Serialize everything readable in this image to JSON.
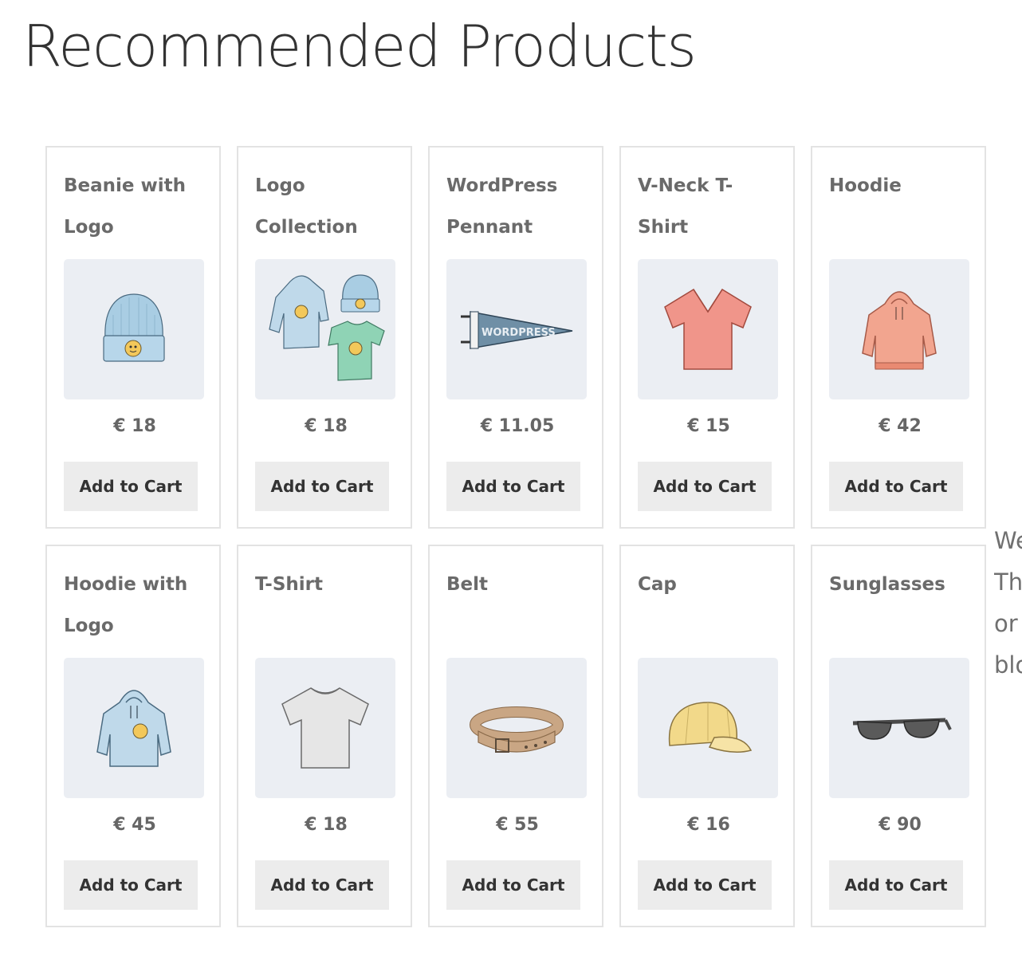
{
  "page": {
    "title": "Recommended Products"
  },
  "side_text": [
    "We",
    "Th",
    "or",
    "blo"
  ],
  "products": [
    {
      "name": "Beanie with Logo",
      "price": "€ 18",
      "cta": "Add to Cart",
      "icon": "beanie-icon"
    },
    {
      "name": "Logo Collection",
      "price": "€ 18",
      "cta": "Add to Cart",
      "icon": "logo-collection-icon"
    },
    {
      "name": "WordPress Pennant",
      "price": "€ 11.05",
      "cta": "Add to Cart",
      "icon": "pennant-icon",
      "pennant_text": "WORDPRESS"
    },
    {
      "name": "V-Neck T-Shirt",
      "price": "€ 15",
      "cta": "Add to Cart",
      "icon": "vneck-tshirt-icon"
    },
    {
      "name": "Hoodie",
      "price": "€ 42",
      "cta": "Add to Cart",
      "icon": "hoodie-icon"
    },
    {
      "name": "Hoodie with Logo",
      "price": "€ 45",
      "cta": "Add to Cart",
      "icon": "hoodie-with-logo-icon"
    },
    {
      "name": "T-Shirt",
      "price": "€ 18",
      "cta": "Add to Cart",
      "icon": "tshirt-icon"
    },
    {
      "name": "Belt",
      "price": "€ 55",
      "cta": "Add to Cart",
      "icon": "belt-icon"
    },
    {
      "name": "Cap",
      "price": "€ 16",
      "cta": "Add to Cart",
      "icon": "cap-icon"
    },
    {
      "name": "Sunglasses",
      "price": "€ 90",
      "cta": "Add to Cart",
      "icon": "sunglasses-icon"
    }
  ],
  "colors": {
    "card_border": "#e3e3e3",
    "thumb_bg": "#ebeef3",
    "button_bg": "#ececec",
    "light_blue": "#a9cde3",
    "mint": "#8fd3b5",
    "coral": "#f0958a",
    "orange": "#f2a58f",
    "gray_shirt": "#e6e6e6",
    "tan": "#c9a684",
    "yellow": "#f2d98a",
    "dark_gray": "#5a5a5a",
    "emoji": "#f3c85a"
  }
}
